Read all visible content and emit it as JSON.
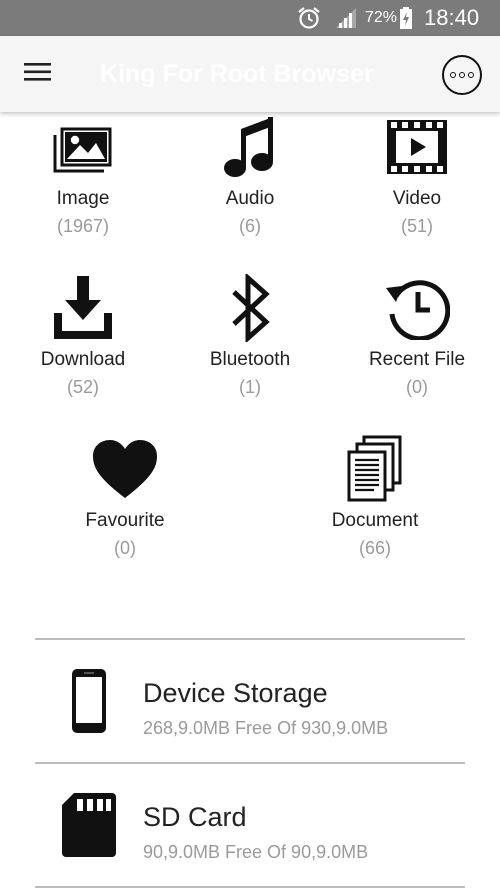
{
  "status_bar": {
    "battery": "72%",
    "time": "18:40",
    "icons": [
      "alarm-icon",
      "signal-icon",
      "battery-charging-icon"
    ]
  },
  "app_bar": {
    "title": "King For Root Browser",
    "menu_icon": "hamburger-icon",
    "more_icon": "more-options-icon"
  },
  "categories": [
    {
      "label": "Image",
      "count": "(1967)",
      "icon": "image-icon"
    },
    {
      "label": "Audio",
      "count": "(6)",
      "icon": "music-note-icon"
    },
    {
      "label": "Video",
      "count": "(51)",
      "icon": "video-icon"
    },
    {
      "label": "Download",
      "count": "(52)",
      "icon": "download-icon"
    },
    {
      "label": "Bluetooth",
      "count": "(1)",
      "icon": "bluetooth-icon"
    },
    {
      "label": "Recent File",
      "count": "(0)",
      "icon": "history-icon"
    },
    {
      "label": "Favourite",
      "count": "(0)",
      "icon": "heart-icon"
    },
    {
      "label": "Document",
      "count": "(66)",
      "icon": "document-icon"
    }
  ],
  "storage": [
    {
      "name": "Device Storage",
      "info": "268,9.0MB Free Of 930,9.0MB",
      "icon": "phone-icon"
    },
    {
      "name": "SD Card",
      "info": "90,9.0MB Free Of 90,9.0MB",
      "icon": "sd-card-icon"
    }
  ],
  "colors": {
    "status_bar": "#7b7b7b",
    "app_bar": "#f5f5f5",
    "count_text": "#9a9a9a",
    "divider": "#bdbdbd"
  }
}
